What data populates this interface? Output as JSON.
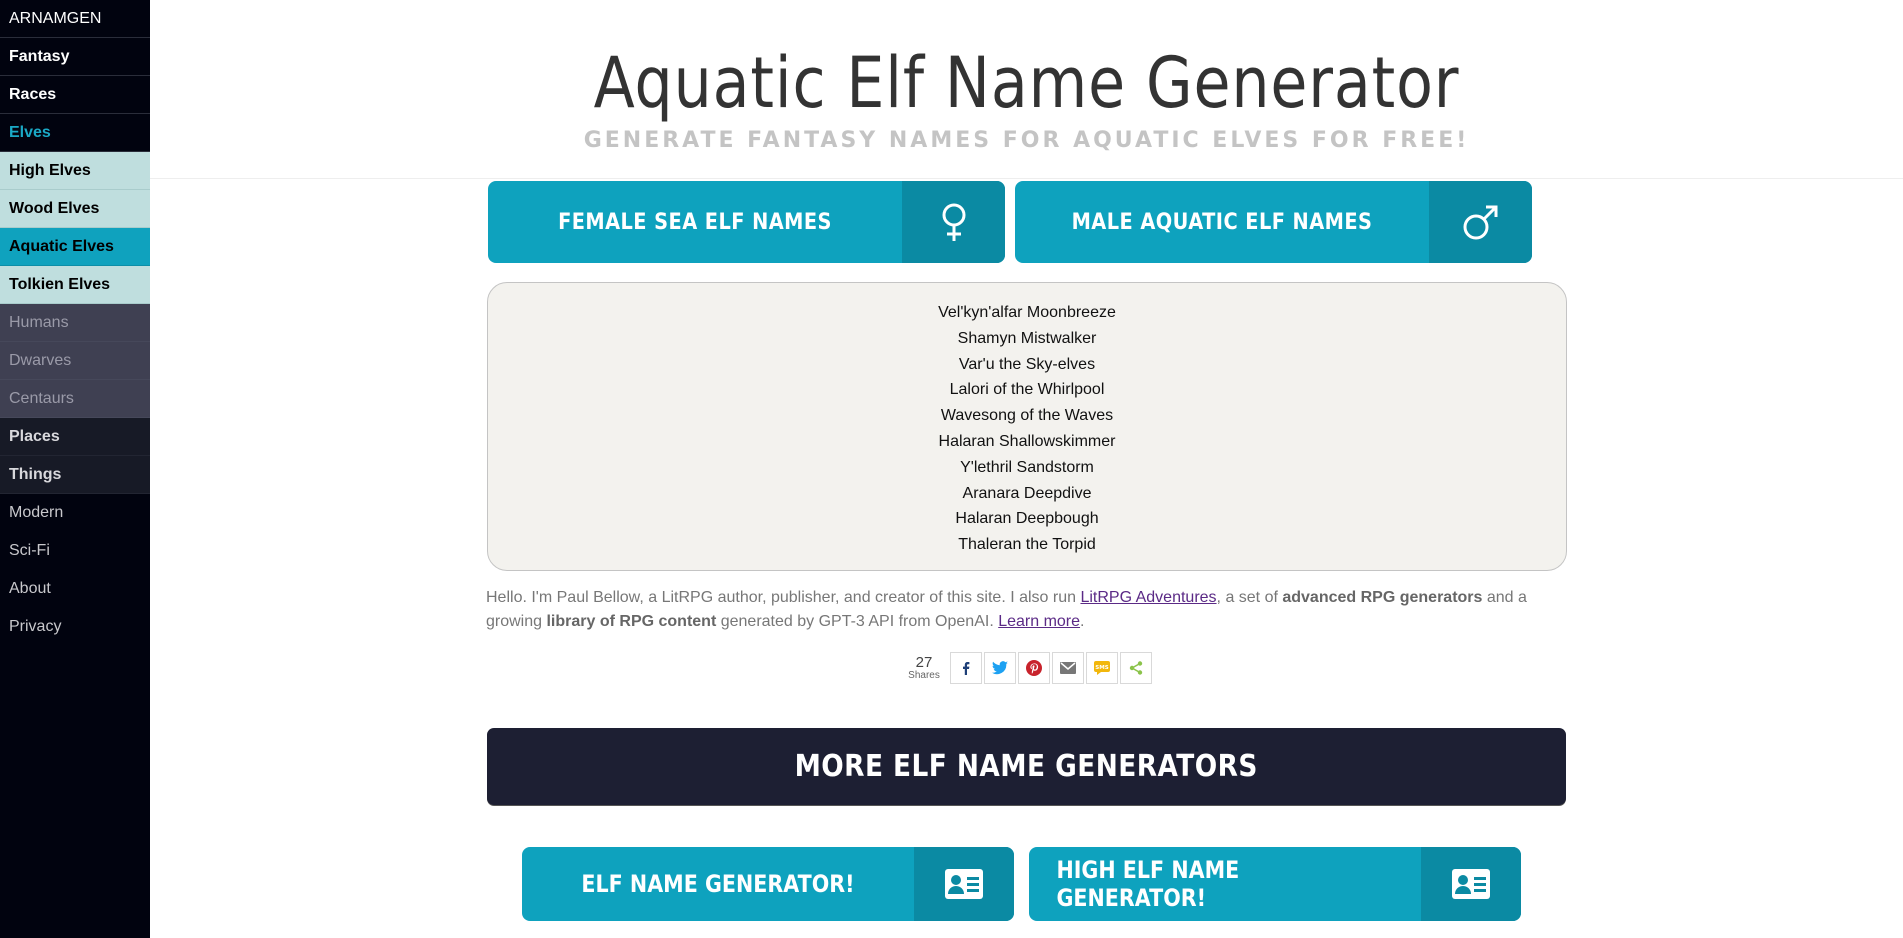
{
  "sidebar": {
    "brand": "ARNAMGEN",
    "items": [
      {
        "label": "Fantasy"
      },
      {
        "label": "Races"
      },
      {
        "label": "Elves"
      },
      {
        "label": "High Elves"
      },
      {
        "label": "Wood Elves"
      },
      {
        "label": "Aquatic Elves"
      },
      {
        "label": "Tolkien Elves"
      },
      {
        "label": "Humans"
      },
      {
        "label": "Dwarves"
      },
      {
        "label": "Centaurs"
      },
      {
        "label": "Places"
      },
      {
        "label": "Things"
      },
      {
        "label": "Modern"
      },
      {
        "label": "Sci-Fi"
      },
      {
        "label": "About"
      },
      {
        "label": "Privacy"
      }
    ]
  },
  "header": {
    "title": "Aquatic Elf Name Generator",
    "subtitle": "GENERATE FANTASY NAMES FOR AQUATIC ELVES FOR FREE!"
  },
  "generator": {
    "female_label": "FEMALE SEA ELF NAMES",
    "male_label": "MALE AQUATIC ELF NAMES",
    "female_icon": "female-symbol-icon",
    "male_icon": "male-symbol-icon"
  },
  "results": [
    "Vel'kyn'alfar Moonbreeze",
    "Shamyn Mistwalker",
    "Var'u the Sky-elves",
    "Lalori of the Whirlpool",
    "Wavesong of the Waves",
    "Halaran Shallowskimmer",
    "Y'lethril Sandstorm",
    "Aranara Deepdive",
    "Halaran Deepbough",
    "Thaleran the Torpid"
  ],
  "bio": {
    "p1": "Hello. I'm Paul Bellow, a LitRPG author, publisher, and creator of this site. I also run ",
    "link1": "LitRPG Adventures",
    "p2": ", a set of ",
    "b1": "advanced RPG generators",
    "p3": " and a growing ",
    "b2": "library of RPG content",
    "p4": " generated by GPT-3 API from OpenAI. ",
    "link2": "Learn more",
    "p5": "."
  },
  "share": {
    "count": "27",
    "count_label": "Shares",
    "buttons": [
      "facebook-icon",
      "twitter-icon",
      "pinterest-icon",
      "email-icon",
      "sms-icon",
      "share-icon"
    ]
  },
  "more": {
    "banner": "MORE ELF NAME GENERATORS",
    "buttons": [
      {
        "label": "ELF NAME GENERATOR!",
        "icon": "id-card-icon"
      },
      {
        "label": "HIGH ELF NAME GENERATOR!",
        "icon": "id-card-icon"
      }
    ]
  },
  "colors": {
    "accent": "#0ea2be",
    "accent_dark": "#0b8aa3",
    "sidebar_bg": "#01030f",
    "banner_bg": "#1d1f33"
  }
}
